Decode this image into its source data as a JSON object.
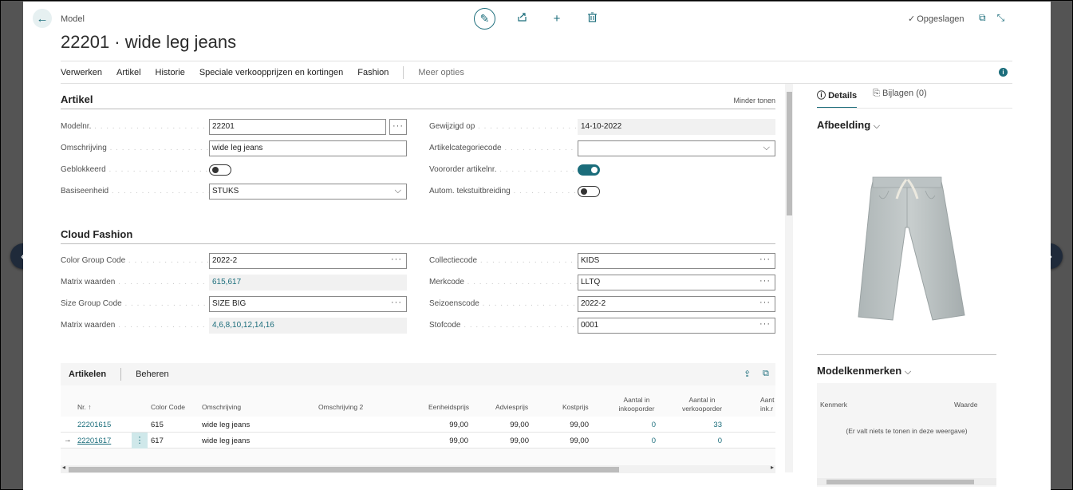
{
  "header": {
    "caption": "Model",
    "title": "22201 · wide leg jeans",
    "saved_label": "Opgeslagen"
  },
  "action_bar": {
    "items": [
      "Verwerken",
      "Artikel",
      "Historie",
      "Speciale verkoopprijzen en kortingen",
      "Fashion"
    ],
    "more": "Meer opties"
  },
  "artikel": {
    "title": "Artikel",
    "less_label": "Minder tonen",
    "modelnr_label": "Modelnr.",
    "modelnr_value": "22201",
    "omschrijving_label": "Omschrijving",
    "omschrijving_value": "wide leg jeans",
    "geblokkeerd_label": "Geblokkeerd",
    "geblokkeerd_value": "off",
    "basiseenheid_label": "Basiseenheid",
    "basiseenheid_value": "STUKS",
    "gewijzigd_label": "Gewijzigd op",
    "gewijzigd_value": "14-10-2022",
    "artikelcategorie_label": "Artikelcategoriecode",
    "artikelcategorie_value": "",
    "voororder_label": "Voororder artikelnr.",
    "voororder_value": "on",
    "autom_label": "Autom. tekstuitbreiding",
    "autom_value": "off"
  },
  "cloud_fashion": {
    "title": "Cloud Fashion",
    "color_group_label": "Color Group Code",
    "color_group_value": "2022-2",
    "matrix1_label": "Matrix waarden",
    "matrix1_value": "615,617",
    "size_group_label": "Size Group Code",
    "size_group_value": "SIZE BIG",
    "matrix2_label": "Matrix waarden",
    "matrix2_value": "4,6,8,10,12,14,16",
    "collectie_label": "Collectiecode",
    "collectie_value": "KIDS",
    "merk_label": "Merkcode",
    "merk_value": "LLTQ",
    "seizoen_label": "Seizoenscode",
    "seizoen_value": "2022-2",
    "stof_label": "Stofcode",
    "stof_value": "0001"
  },
  "artikelen": {
    "title": "Artikelen",
    "manage": "Beheren",
    "columns": {
      "nr": "Nr. ↑",
      "color": "Color Code",
      "omschrijving": "Omschrijving",
      "omschrijving2": "Omschrijving 2",
      "eenheidsprijs": "Eenheidsprijs",
      "adviesprijs": "Adviesprijs",
      "kostprijs": "Kostprijs",
      "inkoop_1": "Aantal in",
      "inkoop_2": "inkooporder",
      "verkoop_1": "Aantal in",
      "verkoop_2": "verkooporder",
      "aant_1": "Aant",
      "aant_2": "ink.r"
    },
    "rows": [
      {
        "nr": "22201615",
        "color": "615",
        "omschrijving": "wide leg jeans",
        "eenheidsprijs": "99,00",
        "adviesprijs": "99,00",
        "kostprijs": "99,00",
        "inkoop": "0",
        "verkoop": "33"
      },
      {
        "nr": "22201617",
        "color": "617",
        "omschrijving": "wide leg jeans",
        "eenheidsprijs": "99,00",
        "adviesprijs": "99,00",
        "kostprijs": "99,00",
        "inkoop": "0",
        "verkoop": "0"
      }
    ]
  },
  "factbox": {
    "tab_details": "Details",
    "tab_attachments": "Bijlagen (0)",
    "image_title": "Afbeelding",
    "kenmerken_title": "Modelkenmerken",
    "col_kenmerk": "Kenmerk",
    "col_waarde": "Waarde",
    "empty": "(Er valt niets te tonen in deze weergave)"
  },
  "colors": {
    "accent": "#1b6d7b",
    "toggle_on": "#1b6d7b"
  },
  "icons": {
    "back": "arrow-left-icon",
    "edit": "pencil-icon",
    "share": "share-icon",
    "new": "plus-icon",
    "delete": "trash-icon",
    "prev": "chevron-left-icon",
    "next": "chevron-right-icon"
  }
}
